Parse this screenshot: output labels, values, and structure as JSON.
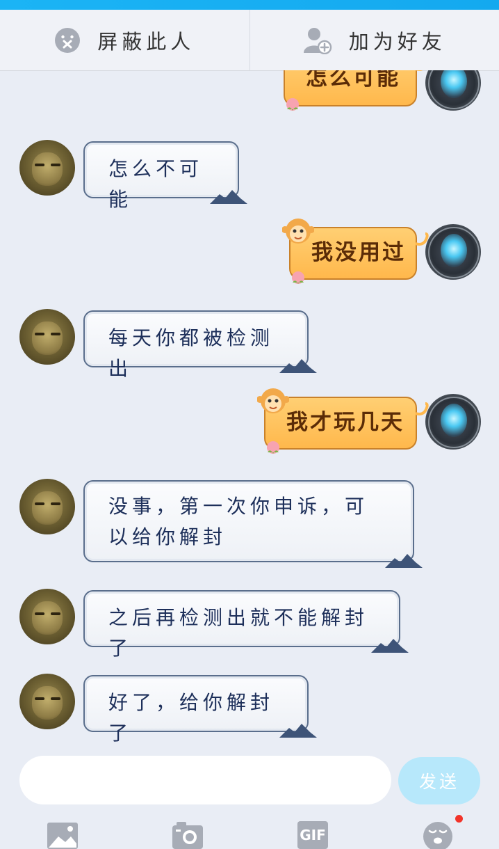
{
  "actions": {
    "block_label": "屏蔽此人",
    "add_friend_label": "加为好友"
  },
  "messages": [
    {
      "side": "right",
      "text": "怎么可能"
    },
    {
      "side": "left",
      "text": "怎么不可能"
    },
    {
      "side": "right",
      "text": "我没用过"
    },
    {
      "side": "left",
      "text": "每天你都被检测出"
    },
    {
      "side": "right",
      "text": "我才玩几天"
    },
    {
      "side": "left",
      "text": "没事，第一次你申诉，可以给你解封"
    },
    {
      "side": "left",
      "text": "之后再检测出就不能解封了"
    },
    {
      "side": "left",
      "text": "好了，给你解封了"
    }
  ],
  "composer": {
    "input_value": "",
    "send_label": "发送"
  },
  "toolbar": {
    "gif_label": "GIF",
    "icons": [
      "image-icon",
      "camera-icon",
      "gif-icon",
      "emoji-icon"
    ],
    "emoji_badge_color": "#f2342a"
  },
  "colors": {
    "top_bar": "#1bb4f5",
    "right_bubble": "#ffc463",
    "left_bubble_border": "#5a6e8c",
    "send_button": "#b7e8fb"
  }
}
